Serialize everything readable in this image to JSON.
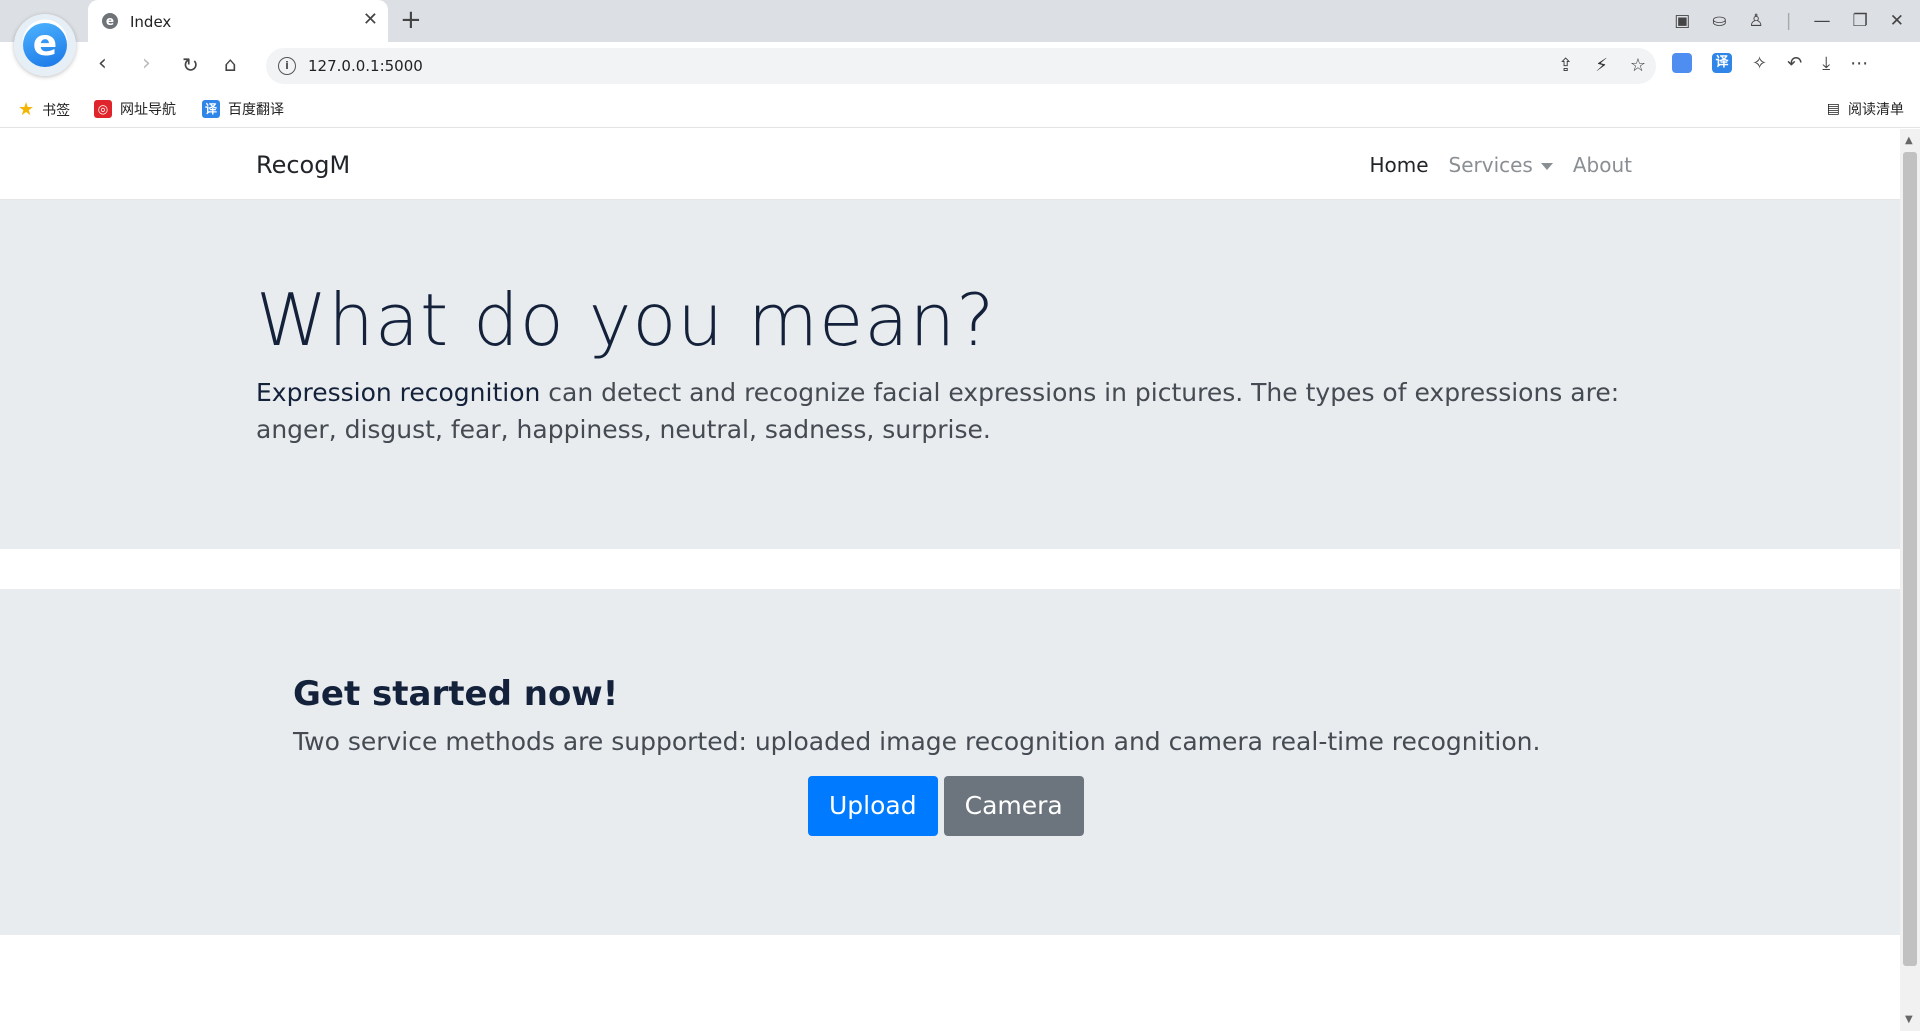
{
  "browser": {
    "tab_title": "Index",
    "tab_favicon": "e",
    "logo_letter": "e",
    "url": "127.0.0.1:5000",
    "bookmarks": [
      {
        "label": "书签",
        "icon": "star-icon"
      },
      {
        "label": "网址导航",
        "icon": "navigation-icon"
      },
      {
        "label": "百度翻译",
        "icon": "translate-icon"
      }
    ],
    "reading_list": "阅读清单",
    "ext_translate": "译"
  },
  "navbar": {
    "brand": "RecogM",
    "links": [
      {
        "label": "Home"
      },
      {
        "label": "Services"
      },
      {
        "label": "About"
      }
    ]
  },
  "jumbotron": {
    "title": "What do you mean?",
    "lead_strong": "Expression recognition",
    "lead_rest": " can detect and recognize facial expressions in pictures. The types of expressions are: anger, disgust, fear, happiness, neutral, sadness, surprise."
  },
  "get_started": {
    "title": "Get started now!",
    "text": "Two service methods are supported: uploaded image recognition and camera real-time recognition.",
    "upload_label": "Upload",
    "camera_label": "Camera"
  },
  "colors": {
    "primary": "#007bff",
    "secondary": "#6c757d",
    "jumbotron_bg": "#e9ecef"
  }
}
